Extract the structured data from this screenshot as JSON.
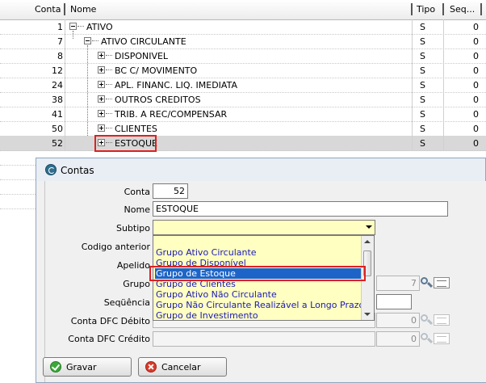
{
  "grid": {
    "headers": {
      "conta": "Conta",
      "nome": "Nome",
      "tipo": "Tipo",
      "seq": "Seq..."
    },
    "rows": [
      {
        "conta": "1",
        "nome": "ATIVO",
        "tipo": "S",
        "seq": "0"
      },
      {
        "conta": "7",
        "nome": "ATIVO CIRCULANTE",
        "tipo": "S",
        "seq": "0"
      },
      {
        "conta": "8",
        "nome": "DISPONIVEL",
        "tipo": "S",
        "seq": "0"
      },
      {
        "conta": "12",
        "nome": "BC C/ MOVIMENTO",
        "tipo": "S",
        "seq": "0"
      },
      {
        "conta": "24",
        "nome": "APL. FINANC. LIQ. IMEDIATA",
        "tipo": "S",
        "seq": "0"
      },
      {
        "conta": "38",
        "nome": "OUTROS CREDITOS",
        "tipo": "S",
        "seq": "0"
      },
      {
        "conta": "41",
        "nome": "TRIB. A REC/COMPENSAR",
        "tipo": "S",
        "seq": "0"
      },
      {
        "conta": "50",
        "nome": "CLIENTES",
        "tipo": "S",
        "seq": "0"
      },
      {
        "conta": "52",
        "nome": "ESTOQUE",
        "tipo": "S",
        "seq": "0"
      }
    ]
  },
  "dialog": {
    "title": "Contas",
    "labels": {
      "conta": "Conta",
      "nome": "Nome",
      "subtipo": "Subtipo",
      "codigo_anterior": "Codigo anterior",
      "apelido": "Apelido",
      "grupo": "Grupo",
      "sequencia": "Seqüência",
      "dfc_debito": "Conta DFC Débito",
      "dfc_credito": "Conta DFC Crédito"
    },
    "values": {
      "conta": "52",
      "nome": "ESTOQUE",
      "subtipo": "",
      "grupo": "7",
      "dfc_debito": "0",
      "dfc_credito": "0"
    },
    "subtipo_options": [
      "",
      "Grupo Ativo Circulante",
      "Grupo de Disponível",
      "Grupo de Estoque",
      "Grupo de Clientes",
      "Grupo Ativo Não Circulante",
      "Grupo Não Circulante Realizável a Longo Prazo",
      "Grupo de Investimento"
    ],
    "selected_option_index": 3,
    "buttons": {
      "gravar": "Gravar",
      "cancelar": "Cancelar"
    }
  },
  "colors": {
    "highlight": "#e02020",
    "selected": "#1e64c8",
    "dropdown_bg": "#ffffc2"
  }
}
